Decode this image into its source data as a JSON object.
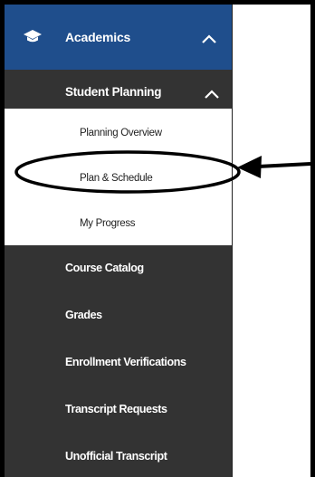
{
  "sidebar": {
    "section": {
      "label": "Academics",
      "icon": "graduation-cap-icon",
      "expanded": true
    },
    "group": {
      "label": "Student Planning",
      "expanded": true
    },
    "subitems": [
      {
        "label": "Planning Overview"
      },
      {
        "label": "Plan & Schedule",
        "highlighted": true
      },
      {
        "label": "My Progress"
      }
    ],
    "items": [
      {
        "label": "Course Catalog"
      },
      {
        "label": "Grades"
      },
      {
        "label": "Enrollment Verifications"
      },
      {
        "label": "Transcript Requests"
      },
      {
        "label": "Unofficial Transcript"
      }
    ]
  },
  "colors": {
    "section_bg": "#1f4e8c",
    "nav_bg": "#333333",
    "subnav_bg": "#ffffff",
    "annotation": "#000000"
  }
}
